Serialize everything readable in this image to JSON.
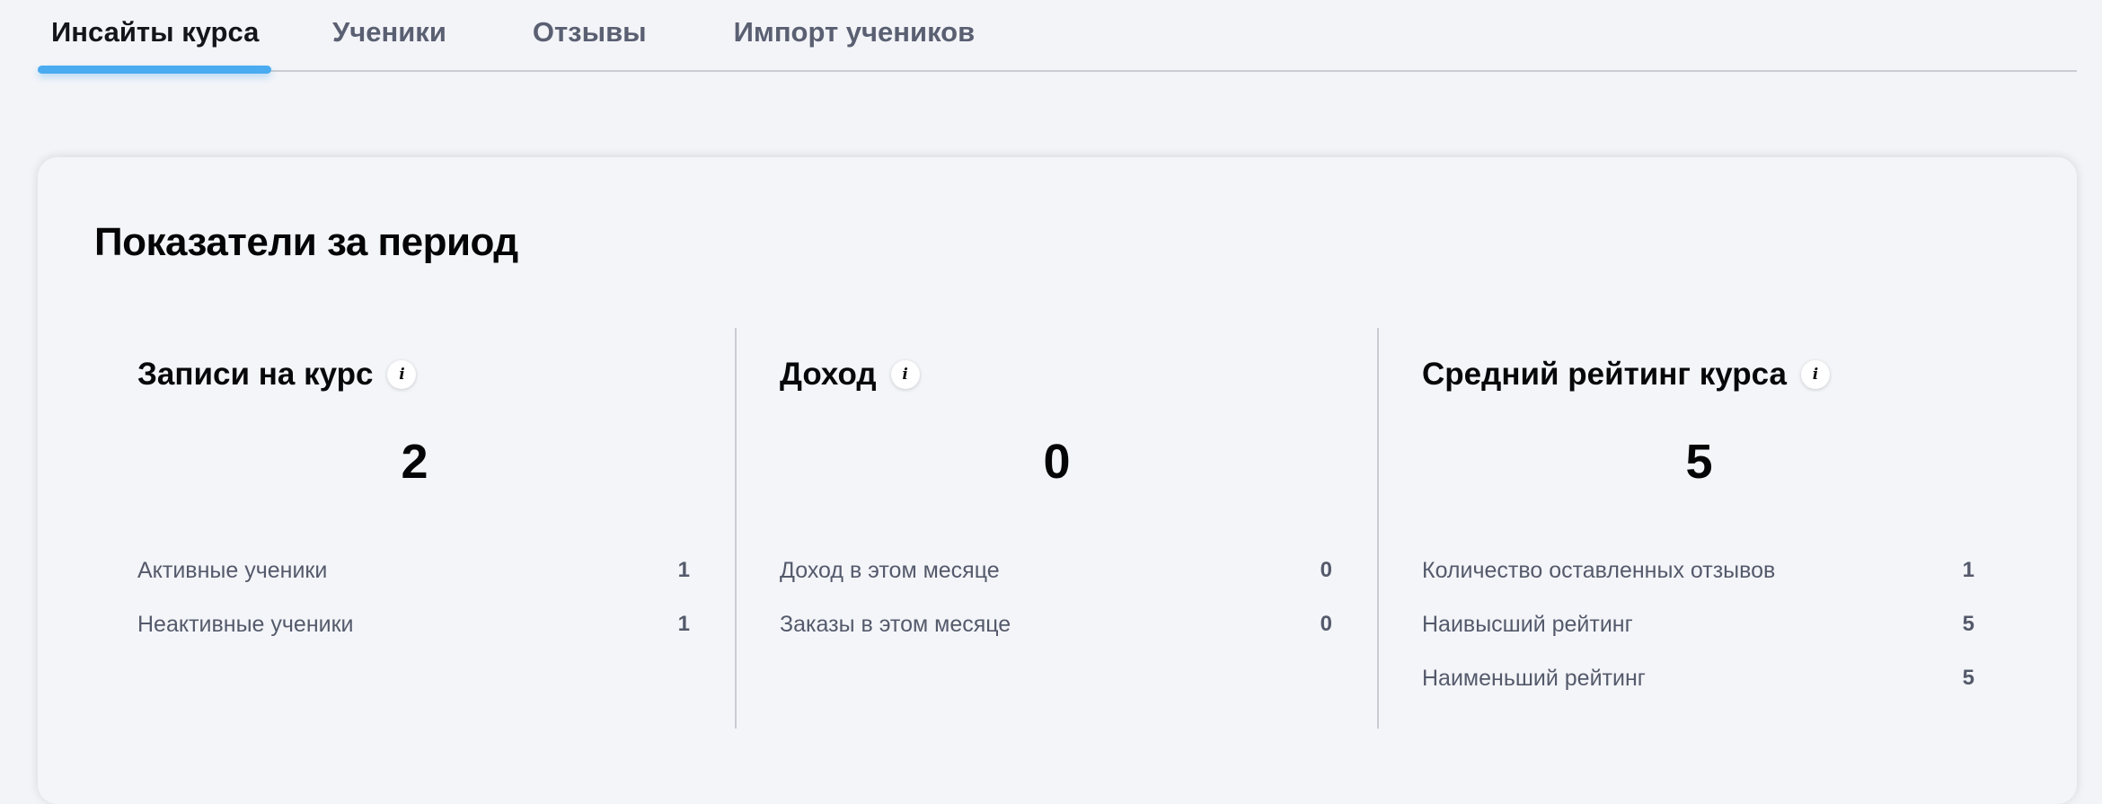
{
  "tabs": [
    {
      "label": "Инсайты курса",
      "active": true
    },
    {
      "label": "Ученики",
      "active": false
    },
    {
      "label": "Отзывы",
      "active": false
    },
    {
      "label": "Импорт учеников",
      "active": false
    }
  ],
  "colors": {
    "accent": "#4aabf0",
    "background": "#f3f4f8",
    "muted_text": "#545a6b"
  },
  "card": {
    "title": "Показатели за период",
    "metrics": [
      {
        "title": "Записи на курс",
        "icon": "info-icon",
        "value": "2",
        "stats": [
          {
            "label": "Активные ученики",
            "value": "1"
          },
          {
            "label": "Неактивные ученики",
            "value": "1"
          }
        ]
      },
      {
        "title": "Доход",
        "icon": "info-icon",
        "value": "0",
        "stats": [
          {
            "label": "Доход в этом месяце",
            "value": "0"
          },
          {
            "label": "Заказы в этом месяце",
            "value": "0"
          }
        ]
      },
      {
        "title": "Средний рейтинг курса",
        "icon": "info-icon",
        "value": "5",
        "stats": [
          {
            "label": "Количество оставленных отзывов",
            "value": "1"
          },
          {
            "label": "Наивысший рейтинг",
            "value": "5"
          },
          {
            "label": "Наименьший рейтинг",
            "value": "5"
          }
        ]
      }
    ]
  }
}
